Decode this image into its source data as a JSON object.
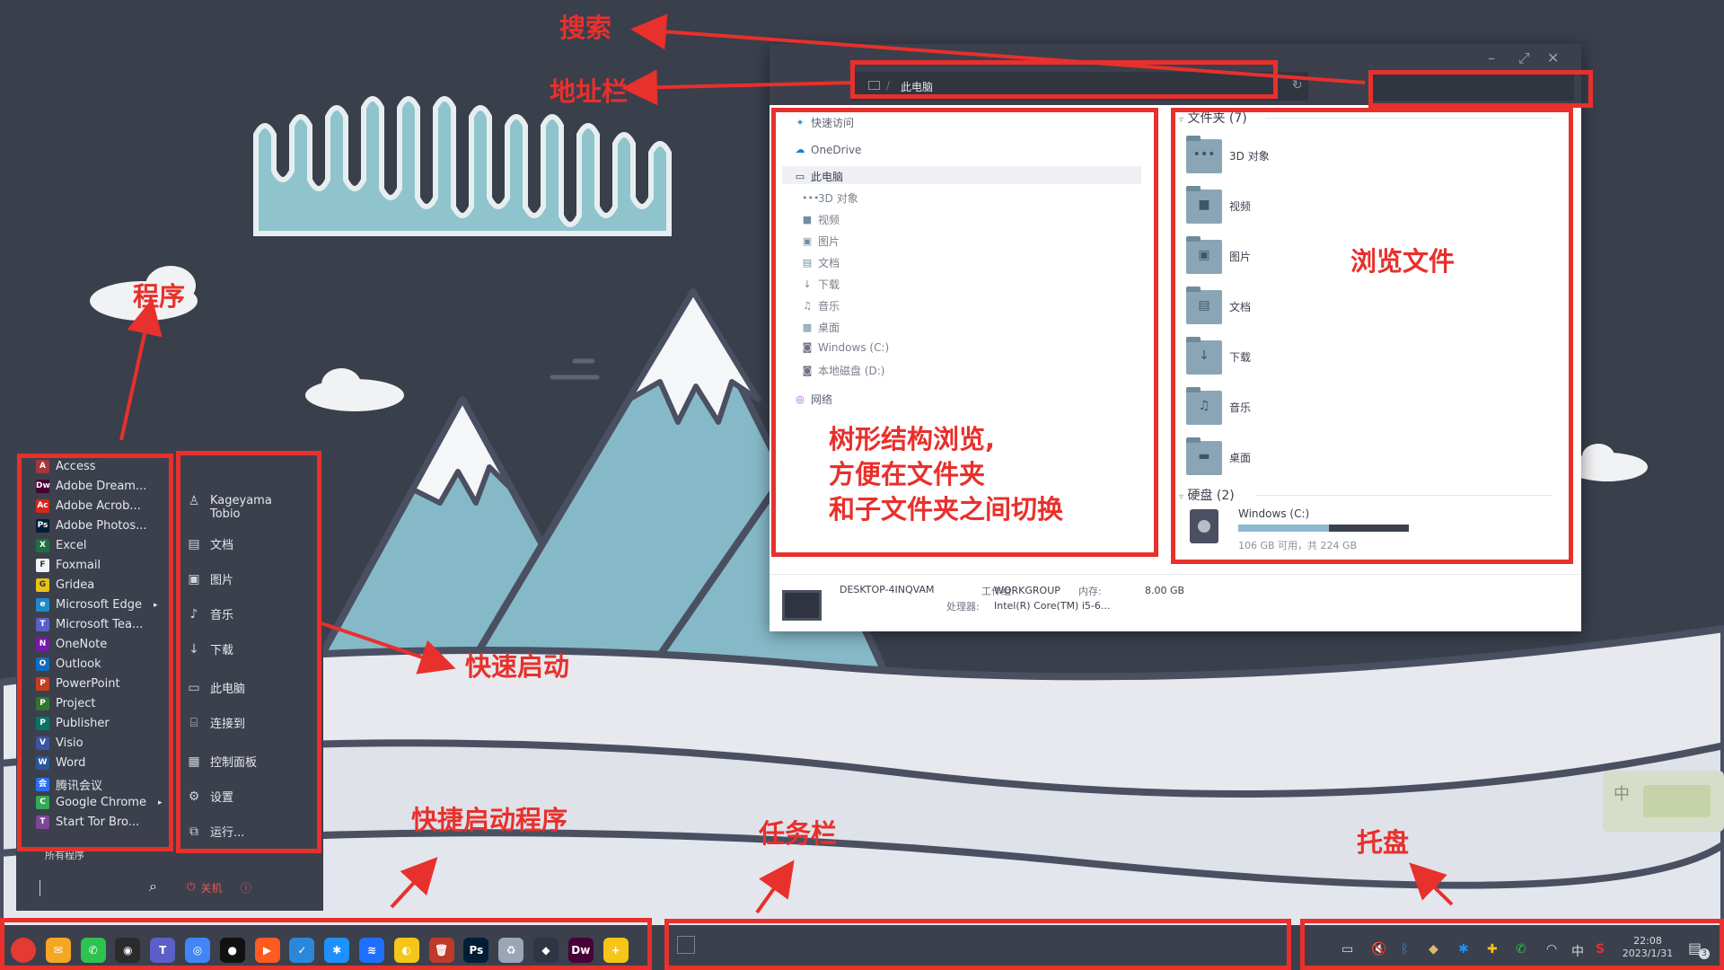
{
  "annotations": {
    "search": "搜索",
    "addressbar": "地址栏",
    "programs": "程序",
    "browse_files": "浏览文件",
    "tree_line1": "树形结构浏览,",
    "tree_line2": "方便在文件夹",
    "tree_line3": "和子文件夹之间切换",
    "quick_launch": "快速启动",
    "shortcut_programs": "快捷启动程序",
    "taskbar": "任务栏",
    "tray": "托盘"
  },
  "explorer": {
    "window_controls": {
      "minimize": "–",
      "maximize": "⤢",
      "close": "✕"
    },
    "address": {
      "path": "此电脑",
      "sep": "/",
      "dropdown": "⌄",
      "refresh": "↻"
    },
    "nav": {
      "quick_access": "快速访问",
      "onedrive": "OneDrive",
      "this_pc": "此电脑",
      "children": [
        "3D 对象",
        "视频",
        "图片",
        "文档",
        "下载",
        "音乐",
        "桌面",
        "Windows (C:)",
        "本地磁盘 (D:)"
      ],
      "network": "网络"
    },
    "folders_header": "文件夹 (7)",
    "folders": [
      "3D 对象",
      "视频",
      "图片",
      "文档",
      "下载",
      "音乐",
      "桌面"
    ],
    "drives_header": "硬盘 (2)",
    "drive": {
      "name": "Windows (C:)",
      "usage_text": "106 GB 可用，共 224 GB",
      "used_fraction": 0.53
    },
    "details": {
      "computer_name": "DESKTOP-4INQVAM",
      "workgroup_label": "工作组:",
      "workgroup": "WORKGROUP",
      "memory_label": "内存:",
      "memory": "8.00 GB",
      "cpu_label": "处理器:",
      "cpu": "Intel(R) Core(TM) i5-6..."
    }
  },
  "startmenu": {
    "apps": [
      {
        "name": "Access",
        "icon": "A",
        "color": "#a4373a"
      },
      {
        "name": "Adobe Dream...",
        "icon": "Dw",
        "color": "#470137"
      },
      {
        "name": "Adobe Acrob...",
        "icon": "Ac",
        "color": "#d8261d"
      },
      {
        "name": "Adobe Photos...",
        "icon": "Ps",
        "color": "#001e36"
      },
      {
        "name": "Excel",
        "icon": "X",
        "color": "#1d6f42"
      },
      {
        "name": "Foxmail",
        "icon": "F",
        "color": "#f3f3f3"
      },
      {
        "name": "Gridea",
        "icon": "G",
        "color": "#e6c21a"
      },
      {
        "name": "Microsoft Edge",
        "icon": "e",
        "color": "#1d8ac9",
        "arrow": "▸"
      },
      {
        "name": "Microsoft Tea...",
        "icon": "T",
        "color": "#5b5fc7"
      },
      {
        "name": "OneNote",
        "icon": "N",
        "color": "#7719aa"
      },
      {
        "name": "Outlook",
        "icon": "O",
        "color": "#0f6cbd"
      },
      {
        "name": "PowerPoint",
        "icon": "P",
        "color": "#c43e1c"
      },
      {
        "name": "Project",
        "icon": "P",
        "color": "#31752f"
      },
      {
        "name": "Publisher",
        "icon": "P",
        "color": "#077568"
      },
      {
        "name": "Visio",
        "icon": "V",
        "color": "#3955a3"
      },
      {
        "name": "Word",
        "icon": "W",
        "color": "#2b579a"
      },
      {
        "name": "腾讯会议",
        "icon": "会",
        "color": "#2a6ef5"
      },
      {
        "name": "Google Chrome",
        "icon": "C",
        "color": "#34a853",
        "arrow": "▸"
      },
      {
        "name": "Start Tor Bro...",
        "icon": "T",
        "color": "#7d4698"
      }
    ],
    "all_programs": "所有程序",
    "user": {
      "line1": "Kageyama",
      "line2": "Tobio"
    },
    "places": [
      "文档",
      "图片",
      "音乐",
      "下载",
      "此电脑",
      "连接到",
      "控制面板",
      "设置",
      "运行..."
    ],
    "shutdown": "关机",
    "search_icon": "⌕"
  },
  "taskbar": {
    "pinned": [
      {
        "name": "start-orb",
        "label": "",
        "color": "#e53935"
      },
      {
        "name": "foxmail",
        "label": "✉",
        "color": "#f5a623"
      },
      {
        "name": "wechat",
        "label": "✆",
        "color": "#2ec24f"
      },
      {
        "name": "obs",
        "label": "◉",
        "color": "#2b2b2b"
      },
      {
        "name": "teams",
        "label": "T",
        "color": "#5b5fc7"
      },
      {
        "name": "chrome",
        "label": "◎",
        "color": "#4285f4"
      },
      {
        "name": "recorder",
        "label": "●",
        "color": "#111111"
      },
      {
        "name": "app-orange",
        "label": "▶",
        "color": "#ff5a1f"
      },
      {
        "name": "todo",
        "label": "✓",
        "color": "#2b88d8"
      },
      {
        "name": "sparkle",
        "label": "✱",
        "color": "#1e90ff"
      },
      {
        "name": "feishu",
        "label": "≋",
        "color": "#1f6fff"
      },
      {
        "name": "swirl",
        "label": "◐",
        "color": "#f5c518"
      },
      {
        "name": "trash",
        "label": "🗑",
        "color": "#c0392b"
      },
      {
        "name": "photoshop",
        "label": "Ps",
        "color": "#001e36"
      },
      {
        "name": "recycle",
        "label": "♻",
        "color": "#9aa6b5"
      },
      {
        "name": "mascot",
        "label": "◆",
        "color": "#2f3545"
      },
      {
        "name": "dreamweaver",
        "label": "Dw",
        "color": "#470137"
      },
      {
        "name": "plus-app",
        "label": "+",
        "color": "#f5c518"
      }
    ],
    "time": "22:08",
    "date": "2023/1/31",
    "ime": "中",
    "notifications": "3"
  },
  "widget": {
    "ime": "中"
  }
}
